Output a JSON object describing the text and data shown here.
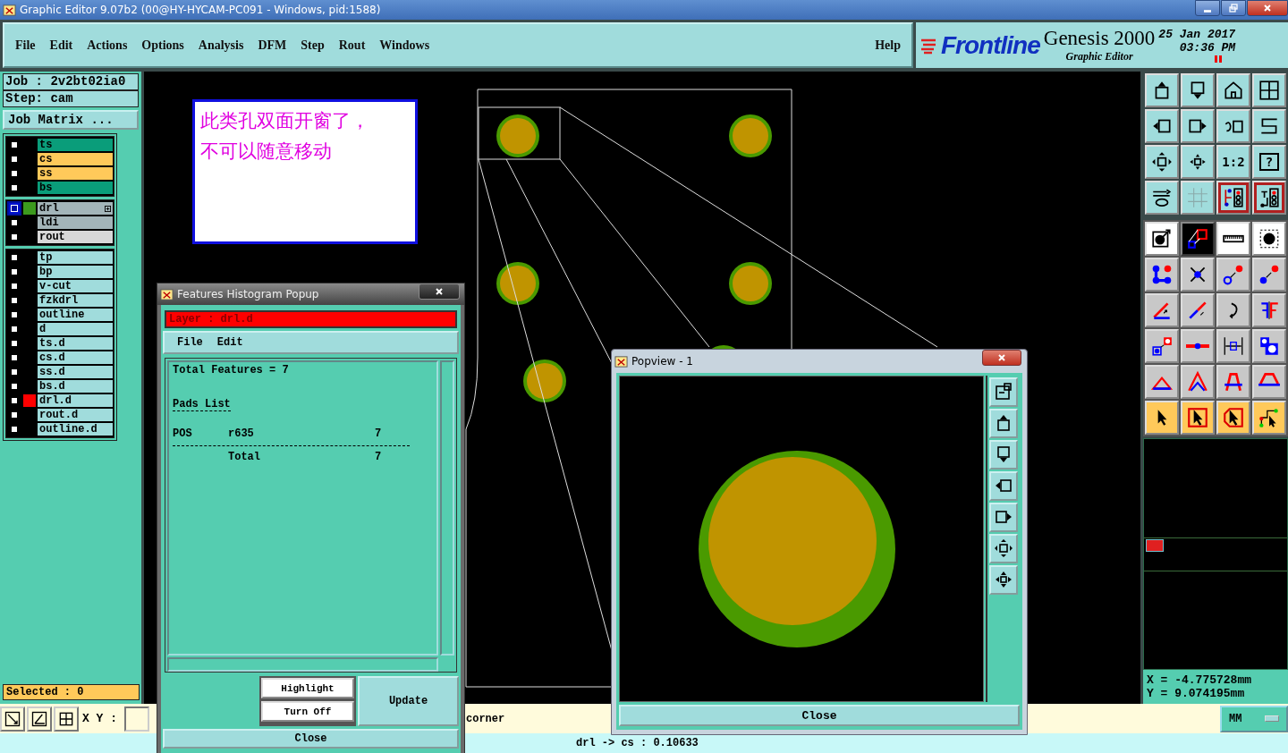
{
  "window": {
    "title": "Graphic Editor 9.07b2 (00@HY-HYCAM-PC091 - Windows, pid:1588)"
  },
  "menu": [
    {
      "label": "File"
    },
    {
      "label": "Edit"
    },
    {
      "label": "Actions"
    },
    {
      "label": "Options"
    },
    {
      "label": "Analysis"
    },
    {
      "label": "DFM"
    },
    {
      "label": "Step"
    },
    {
      "label": "Rout"
    },
    {
      "label": "Windows"
    }
  ],
  "help": "Help",
  "brand": {
    "logo": "Frontline",
    "product": "Genesis 2000",
    "subtitle": "Graphic Editor",
    "date": "25 Jan 2017",
    "time": "03:36 PM"
  },
  "job": "Job : 2v2bt02ia0",
  "step": "Step: cam",
  "job_matrix_button": "Job Matrix ...",
  "layer_groups": [
    [
      {
        "name": "ts",
        "kind": "mask",
        "selected": false
      },
      {
        "name": "cs",
        "kind": "silk",
        "selected": false
      },
      {
        "name": "ss",
        "kind": "silk",
        "selected": false
      },
      {
        "name": "bs",
        "kind": "mask",
        "selected": false
      }
    ],
    [
      {
        "name": "drl",
        "kind": "drill",
        "selected": true,
        "color": "#3c9a1e",
        "expander": true
      },
      {
        "name": "ldi",
        "kind": "drill",
        "selected": false
      },
      {
        "name": "rout",
        "kind": "rout",
        "selected": false
      }
    ],
    [
      {
        "name": "tp",
        "kind": "doc",
        "selected": false
      },
      {
        "name": "bp",
        "kind": "doc",
        "selected": false
      },
      {
        "name": "v-cut",
        "kind": "doc",
        "selected": false
      },
      {
        "name": "fzkdrl",
        "kind": "doc",
        "selected": false
      },
      {
        "name": "outline",
        "kind": "doc",
        "selected": false
      },
      {
        "name": "d",
        "kind": "doc",
        "selected": false
      },
      {
        "name": "ts.d",
        "kind": "doc",
        "selected": false
      },
      {
        "name": "cs.d",
        "kind": "doc",
        "selected": false
      },
      {
        "name": "ss.d",
        "kind": "doc",
        "selected": false
      },
      {
        "name": "bs.d",
        "kind": "doc",
        "selected": false
      },
      {
        "name": "drl.d",
        "kind": "doc",
        "selected": false,
        "color": "#ff0000"
      },
      {
        "name": "rout.d",
        "kind": "doc",
        "selected": false
      },
      {
        "name": "outline.d",
        "kind": "doc",
        "selected": false
      }
    ]
  ],
  "selected_count": "Selected : 0",
  "note": {
    "lines": [
      "此类孔双面开窗了，",
      "不可以随意移动"
    ]
  },
  "toolbar_labels": {
    "scale": "1:2",
    "help": "?"
  },
  "histogram": {
    "title": "Features Histogram Popup",
    "layer": "Layer :  drl.d",
    "menu": [
      "File",
      "Edit"
    ],
    "total": "Total Features = 7",
    "section": "Pads List",
    "rows": [
      {
        "column_1": "POS",
        "column_2": "r635",
        "column_3": "7"
      }
    ],
    "total_row": {
      "label": "Total",
      "value": "7"
    },
    "buttons": {
      "highlight": "Highlight",
      "turn_off": "Turn Off",
      "update": "Update",
      "close": "Close"
    }
  },
  "popview": {
    "title": "Popview - 1",
    "close": "Close"
  },
  "coordinates": {
    "x": "X  =  -4.775728mm",
    "y": "Y  =  9.074195mm"
  },
  "xy_label": "X Y :",
  "message": "corner",
  "units": "MM",
  "status": "drl -> cs : 0.10633"
}
